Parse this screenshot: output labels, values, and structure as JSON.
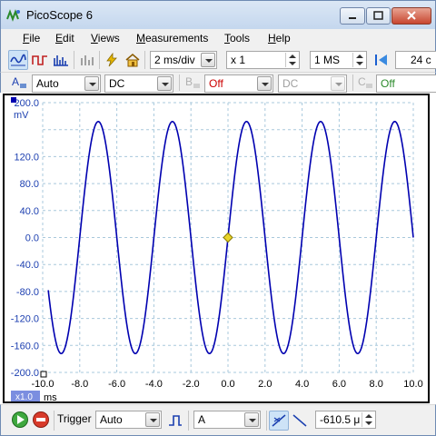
{
  "window": {
    "title": "PicoScope 6"
  },
  "menu": [
    {
      "label": "File",
      "u": "F",
      "rest": "ile"
    },
    {
      "label": "Edit",
      "u": "E",
      "rest": "dit"
    },
    {
      "label": "Views",
      "u": "V",
      "rest": "iews"
    },
    {
      "label": "Measurements",
      "u": "M",
      "rest": "easurements"
    },
    {
      "label": "Tools",
      "u": "T",
      "rest": "ools"
    },
    {
      "label": "Help",
      "u": "H",
      "rest": "elp"
    }
  ],
  "toolbar": {
    "timebase": "2 ms/div",
    "zoom": "x 1",
    "samples": "1 MS",
    "capture_count": "24 c"
  },
  "channels": {
    "a": {
      "letter": "A",
      "range": "Auto",
      "coupling": "DC"
    },
    "b": {
      "letter": "B",
      "range": "Off",
      "coupling": "DC"
    },
    "c": {
      "letter": "C",
      "range": "Off"
    }
  },
  "scope": {
    "y_unit": "mV",
    "y_ticks": [
      "200.0",
      "",
      "120.0",
      "80.0",
      "40.0",
      "0.0",
      "-40.0",
      "-80.0",
      "-120.0",
      "-160.0",
      "-200.0"
    ],
    "x_ticks": [
      "-10.0",
      "-8.0",
      "-6.0",
      "-4.0",
      "-2.0",
      "0.0",
      "2.0",
      "4.0",
      "6.0",
      "8.0",
      "10.0"
    ],
    "x_unit": "ms",
    "x_zoom": "x1.0"
  },
  "chart_data": {
    "type": "line",
    "series": [
      {
        "name": "A",
        "color": "#0000b0",
        "description": "sine wave",
        "amplitude_mV": 172,
        "period_ms": 4.0,
        "crossing_ms": 0.0,
        "ends_at_ms": 10.0
      }
    ],
    "xlim": [
      -10.0,
      10.0
    ],
    "ylim": [
      -200.0,
      200.0
    ],
    "xlabel": "ms",
    "ylabel": "mV",
    "grid": true,
    "trigger_marker": {
      "x": 0.0,
      "y": 0.0,
      "color": "#e8d42a"
    }
  },
  "bottom": {
    "trigger_label": "Trigger",
    "trigger_mode": "Auto",
    "trigger_channel": "A",
    "trigger_time": "-610.5 μ"
  },
  "colors": {
    "accent": "#0000b0",
    "channel_a": "#1c3fb0",
    "off_red": "#cc0000",
    "off_green": "#2b8a2b"
  }
}
